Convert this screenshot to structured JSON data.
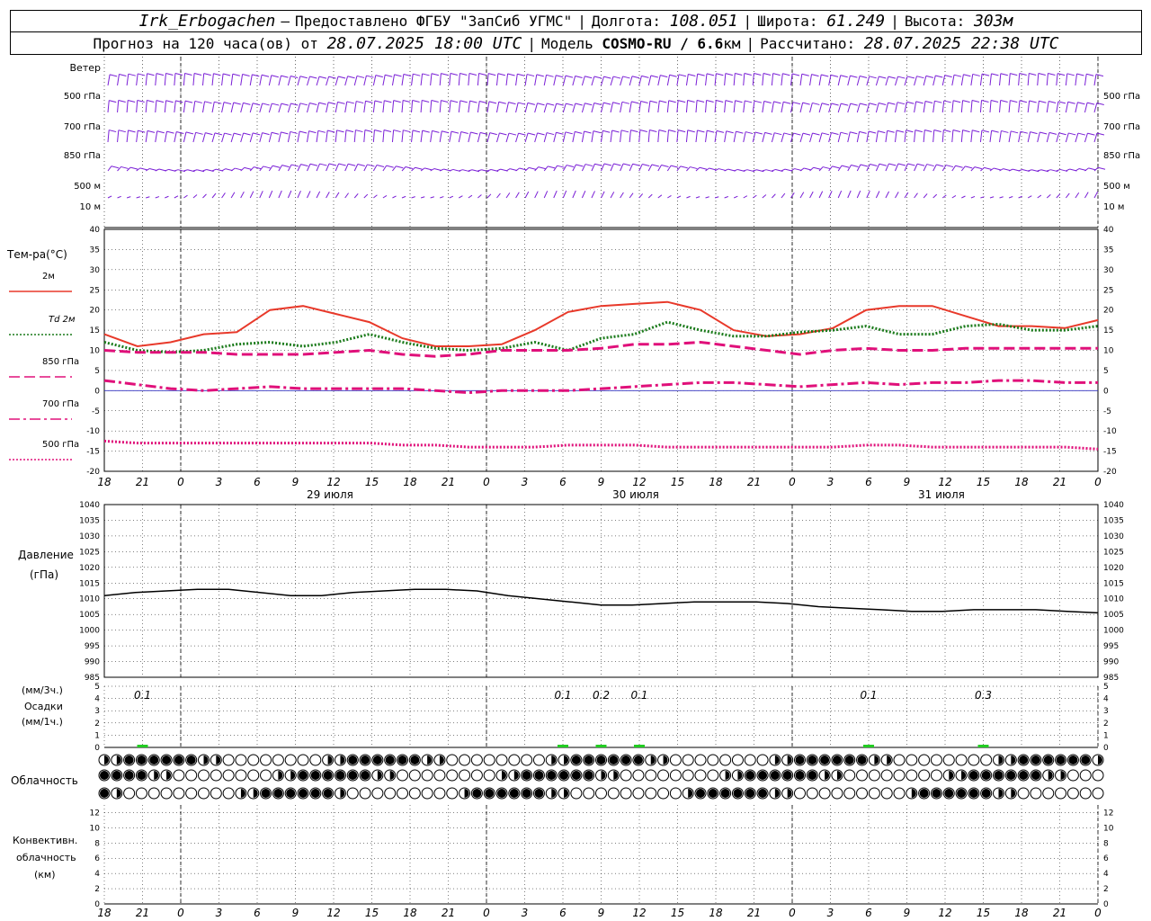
{
  "header": {
    "station": "Irk_Erbogachen",
    "provider": "Предоставлено ФГБУ \"ЗапСиб УГМС\"",
    "lon_label": "Долгота:",
    "lon": "108.051",
    "lat_label": "Широта:",
    "lat": "61.249",
    "alt_label": "Высота:",
    "alt": "303м",
    "forecast_label": "Прогноз на 120 часа(ов) от",
    "forecast_start": "28.07.2025 18:00 UTC",
    "model_label": "Модель",
    "model": "COSMO-RU / 6.6",
    "model_unit": "км",
    "calc_label": "Рассчитано:",
    "calc_time": "28.07.2025 22:38 UTC"
  },
  "time_axis": {
    "hour_labels": [
      "18",
      "21",
      "0",
      "3",
      "6",
      "9",
      "12",
      "15",
      "18",
      "21",
      "0",
      "3",
      "6",
      "9",
      "12",
      "15",
      "18",
      "21",
      "0",
      "3",
      "6",
      "9",
      "12",
      "15",
      "18",
      "21",
      "0"
    ],
    "day_labels": [
      "29 июля",
      "30 июля",
      "31 июля"
    ]
  },
  "wind_panel": {
    "levels": [
      "Ветер",
      "500 гПа",
      "700 гПа",
      "850 гПа",
      "500 м",
      "10 м"
    ],
    "right_levels": [
      "500 гПа",
      "700 гПа",
      "850 гПа",
      "500 м",
      "10 м"
    ],
    "color": "#7a1fd6"
  },
  "temp_panel": {
    "ylabel": "Тем-ра(°C)",
    "legend": [
      {
        "label": "2м",
        "color": "#e8392a",
        "style": "solid"
      },
      {
        "label": "Td 2м",
        "color": "#1a7a1a",
        "style": "dotted"
      },
      {
        "label": "850 гПа",
        "color": "#e0107a",
        "style": "dashed"
      },
      {
        "label": "700 гПа",
        "color": "#e0107a",
        "style": "dashdot"
      },
      {
        "label": "500 гПа",
        "color": "#e0107a",
        "style": "fine"
      }
    ],
    "yticks": [
      "40",
      "35",
      "30",
      "25",
      "20",
      "15",
      "10",
      "5",
      "0",
      "-5",
      "-10",
      "-15",
      "-20"
    ]
  },
  "pressure_panel": {
    "ylabel1": "Давление",
    "ylabel2": "(гПа)",
    "yticks": [
      "1040",
      "1035",
      "1030",
      "1025",
      "1020",
      "1015",
      "1010",
      "1005",
      "1000",
      "995",
      "990",
      "985"
    ]
  },
  "precip_panel": {
    "ylabel1": "(мм/3ч.)",
    "ylabel2": "Осадки",
    "ylabel3": "(мм/1ч.)",
    "yticks": [
      "5",
      "4",
      "3",
      "2",
      "1",
      "0"
    ],
    "amount_labels": [
      {
        "h": 3,
        "text": "0.1"
      },
      {
        "h": 36,
        "text": "0.1"
      },
      {
        "h": 39,
        "text": "0.2"
      },
      {
        "h": 42,
        "text": "0.1"
      },
      {
        "h": 60,
        "text": "0.1"
      },
      {
        "h": 69,
        "text": "0.3"
      }
    ]
  },
  "cloud_panel": {
    "label": "Облачность"
  },
  "conv_panel": {
    "ylabel1": "Конвективн.",
    "ylabel2": "облачность",
    "ylabel3": "(км)",
    "yticks": [
      "12",
      "10",
      "8",
      "6",
      "4",
      "2",
      "0"
    ],
    "color": "#f08a30"
  },
  "chart_data": [
    {
      "type": "line",
      "title": "Тем-ра(°C)",
      "x_hours_from_start": [
        0,
        3,
        6,
        9,
        12,
        15,
        18,
        21,
        24,
        27,
        30,
        33,
        36,
        39,
        42,
        45,
        48,
        51,
        54,
        57,
        60,
        63,
        66,
        69,
        72,
        75,
        78
      ],
      "series": [
        {
          "name": "2м",
          "values": [
            14,
            11,
            12,
            14,
            14.5,
            20,
            21,
            19,
            17,
            13,
            11,
            11,
            11.5,
            15,
            19.5,
            21,
            21.5,
            22,
            20,
            15,
            13.5,
            14,
            15.5,
            20,
            21,
            21,
            18.5,
            16,
            16,
            15.5,
            17.5
          ]
        },
        {
          "name": "Td 2м",
          "values": [
            12,
            10,
            9.5,
            10,
            11.5,
            12,
            11,
            12,
            14,
            12,
            10.5,
            10,
            10.5,
            12,
            10,
            13,
            14,
            17,
            15,
            13.5,
            13.5,
            14.5,
            15,
            16,
            14,
            14,
            16,
            16.5,
            15,
            15,
            16
          ]
        },
        {
          "name": "850 гПа",
          "values": [
            10,
            9.5,
            9.5,
            9.5,
            9,
            9,
            9,
            9.5,
            10,
            9,
            8.5,
            9,
            10,
            10,
            10,
            10.5,
            11.5,
            11.5,
            12,
            11,
            10,
            9,
            10,
            10.5,
            10,
            10,
            10.5,
            10.5,
            10.5,
            10.5,
            10.5
          ]
        },
        {
          "name": "700 гПа",
          "values": [
            2.5,
            1.5,
            0.5,
            0,
            0.5,
            1,
            0.5,
            0.5,
            0.5,
            0.5,
            0,
            -0.5,
            0,
            0,
            0,
            0.5,
            1,
            1.5,
            2,
            2,
            1.5,
            1,
            1.5,
            2,
            1.5,
            2,
            2,
            2.5,
            2.5,
            2,
            2
          ]
        },
        {
          "name": "500 гПа",
          "values": [
            -12.5,
            -13,
            -13,
            -13,
            -13,
            -13,
            -13,
            -13,
            -13,
            -13.5,
            -13.5,
            -14,
            -14,
            -14,
            -13.5,
            -13.5,
            -13.5,
            -14,
            -14,
            -14,
            -14,
            -14,
            -14,
            -13.5,
            -13.5,
            -14,
            -14,
            -14,
            -14,
            -14,
            -14.5
          ]
        }
      ],
      "ylim": [
        -20,
        40
      ]
    },
    {
      "type": "line",
      "title": "Давление (гПа)",
      "series": [
        {
          "name": "Давление",
          "values": [
            1011,
            1012,
            1012.5,
            1013,
            1013,
            1012,
            1011,
            1011,
            1012,
            1012.5,
            1013,
            1013,
            1012.5,
            1011,
            1010,
            1009,
            1008,
            1008,
            1008.5,
            1009,
            1009,
            1009,
            1008.5,
            1007.5,
            1007,
            1006.5,
            1006,
            1006,
            1006.5,
            1006.5,
            1006.5,
            1006,
            1005.5
          ]
        }
      ],
      "ylim": [
        985,
        1040
      ]
    },
    {
      "type": "bar",
      "title": "Конвективн. облачность (км)",
      "ylim": [
        0,
        13
      ]
    }
  ]
}
